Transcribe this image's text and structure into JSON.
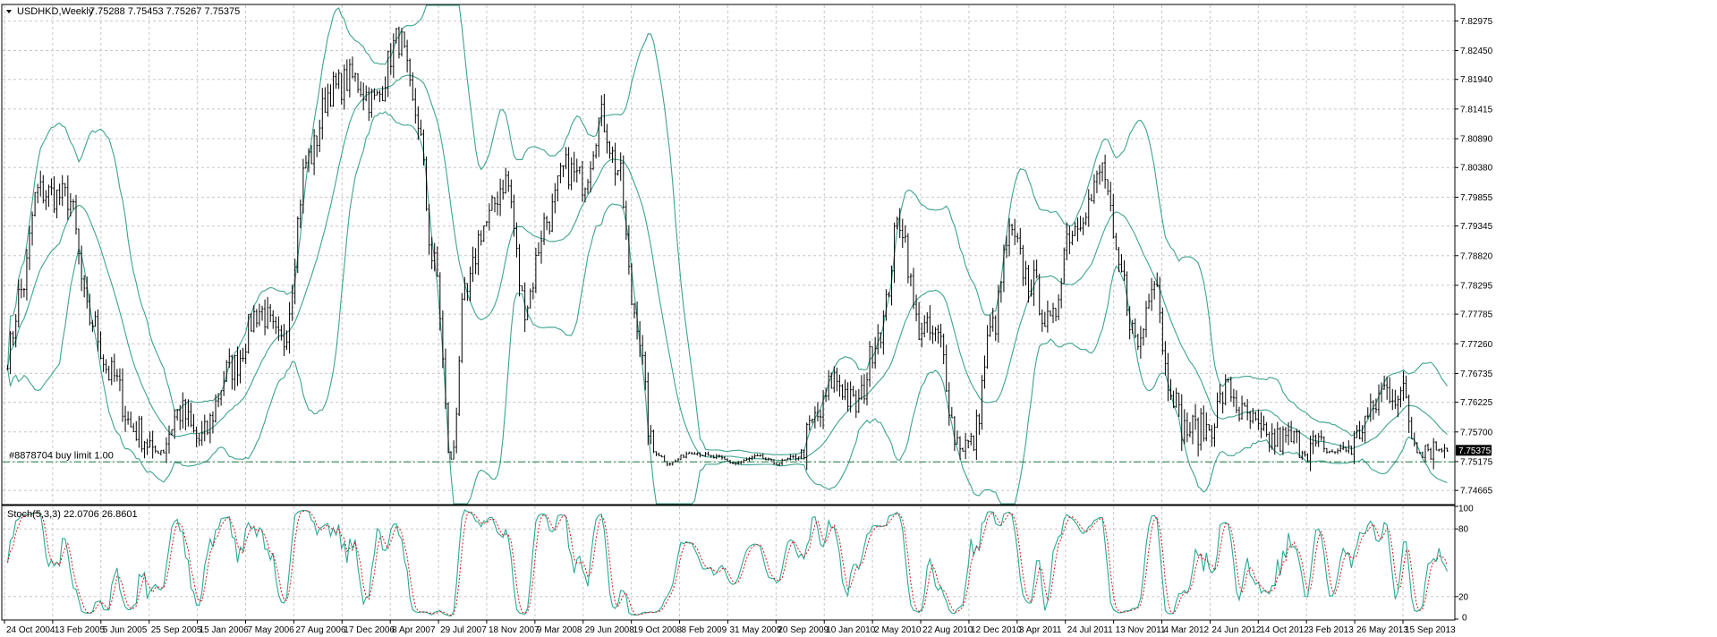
{
  "window": {
    "title": "USDHKD,Weekly",
    "ohlc": "7.75288 7.75453 7.75267 7.75375"
  },
  "order_line": {
    "label": "#8878704 buy limit 1.00",
    "price": 7.7517
  },
  "current_price": {
    "label": "7.75375",
    "value": 7.75375
  },
  "stoch_label": "Stoch(5,3,3) 22.0706 26.8601",
  "colors": {
    "candle": "#000000",
    "bands": "#3fa38e",
    "stoch_main": "#2aa894",
    "stoch_signal": "#d21919",
    "order_line": "#1f7a3f",
    "price_tag_bg": "#000000",
    "price_tag_text": "#ffffff"
  },
  "chart_data": [
    {
      "type": "candlestick",
      "symbol": "USDHKD",
      "timeframe": "Weekly",
      "y_ticks": [
        "7.82975",
        "7.82450",
        "7.81940",
        "7.81415",
        "7.80890",
        "7.80380",
        "7.79855",
        "7.79345",
        "7.78820",
        "7.78295",
        "7.77785",
        "7.77260",
        "7.76735",
        "7.76225",
        "7.75700",
        "7.75175",
        "7.74665"
      ],
      "ylim": [
        7.7443,
        7.8325
      ],
      "x_ticks": [
        "24 Oct 2004",
        "13 Feb 2005",
        "5 Jun 2005",
        "25 Sep 2005",
        "15 Jan 2006",
        "7 May 2006",
        "27 Aug 2006",
        "17 Dec 2006",
        "8 Apr 2007",
        "29 Jul 2007",
        "18 Nov 2007",
        "9 Mar 2008",
        "29 Jun 2008",
        "19 Oct 2008",
        "8 Feb 2009",
        "31 May 2009",
        "20 Sep 2009",
        "10 Jan 2010",
        "2 May 2010",
        "22 Aug 2010",
        "12 Dec 2010",
        "3 Apr 2011",
        "24 Jul 2011",
        "13 Nov 2011",
        "4 Mar 2012",
        "24 Jun 2012",
        "14 Oct 2012",
        "3 Feb 2013",
        "26 May 2013",
        "15 Sep 2013"
      ],
      "series_anchors": [
        [
          0,
          7.771
        ],
        [
          5,
          7.782
        ],
        [
          11,
          7.7995
        ],
        [
          22,
          7.7985
        ],
        [
          30,
          7.777
        ],
        [
          38,
          7.767
        ],
        [
          46,
          7.7575
        ],
        [
          55,
          7.7535
        ],
        [
          63,
          7.7605
        ],
        [
          70,
          7.7555
        ],
        [
          82,
          7.7685
        ],
        [
          92,
          7.7785
        ],
        [
          100,
          7.7725
        ],
        [
          110,
          7.8055
        ],
        [
          118,
          7.8175
        ],
        [
          126,
          7.8195
        ],
        [
          134,
          7.8155
        ],
        [
          143,
          7.8265
        ],
        [
          149,
          7.8135
        ],
        [
          156,
          7.7865
        ],
        [
          162,
          7.752
        ],
        [
          167,
          7.7805
        ],
        [
          174,
          7.7935
        ],
        [
          182,
          7.8015
        ],
        [
          189,
          7.7795
        ],
        [
          197,
          7.7945
        ],
        [
          204,
          7.8035
        ],
        [
          210,
          7.8015
        ],
        [
          217,
          7.8125
        ],
        [
          223,
          7.8035
        ],
        [
          229,
          7.7785
        ],
        [
          236,
          7.7535
        ],
        [
          242,
          7.7515
        ],
        [
          250,
          7.7535
        ],
        [
          258,
          7.7525
        ],
        [
          266,
          7.7515
        ],
        [
          274,
          7.7525
        ],
        [
          281,
          7.7515
        ],
        [
          288,
          7.7525
        ],
        [
          296,
          7.7595
        ],
        [
          302,
          7.7665
        ],
        [
          310,
          7.7615
        ],
        [
          319,
          7.7755
        ],
        [
          326,
          7.7945
        ],
        [
          333,
          7.7755
        ],
        [
          340,
          7.7735
        ],
        [
          347,
          7.7555
        ],
        [
          352,
          7.7545
        ],
        [
          360,
          7.7755
        ],
        [
          366,
          7.7915
        ],
        [
          374,
          7.7835
        ],
        [
          381,
          7.7755
        ],
        [
          388,
          7.7925
        ],
        [
          395,
          7.7975
        ],
        [
          400,
          7.8035
        ],
        [
          406,
          7.7855
        ],
        [
          413,
          7.7725
        ],
        [
          419,
          7.7855
        ],
        [
          424,
          7.7665
        ],
        [
          430,
          7.7575
        ],
        [
          438,
          7.7575
        ],
        [
          446,
          7.7645
        ],
        [
          452,
          7.7595
        ],
        [
          460,
          7.7555
        ],
        [
          468,
          7.7555
        ],
        [
          476,
          7.7545
        ],
        [
          484,
          7.7535
        ],
        [
          491,
          7.7545
        ],
        [
          497,
          7.7595
        ],
        [
          503,
          7.7645
        ],
        [
          510,
          7.7635
        ],
        [
          514,
          7.7555
        ],
        [
          520,
          7.7545
        ],
        [
          526,
          7.7538
        ]
      ]
    },
    {
      "type": "line",
      "indicator": "Stoch(5,3,3)",
      "y_ticks": [
        "100",
        "80",
        "20",
        "0"
      ],
      "ylim": [
        0,
        100
      ],
      "current": {
        "main": 22.0706,
        "signal": 26.8601
      }
    }
  ]
}
